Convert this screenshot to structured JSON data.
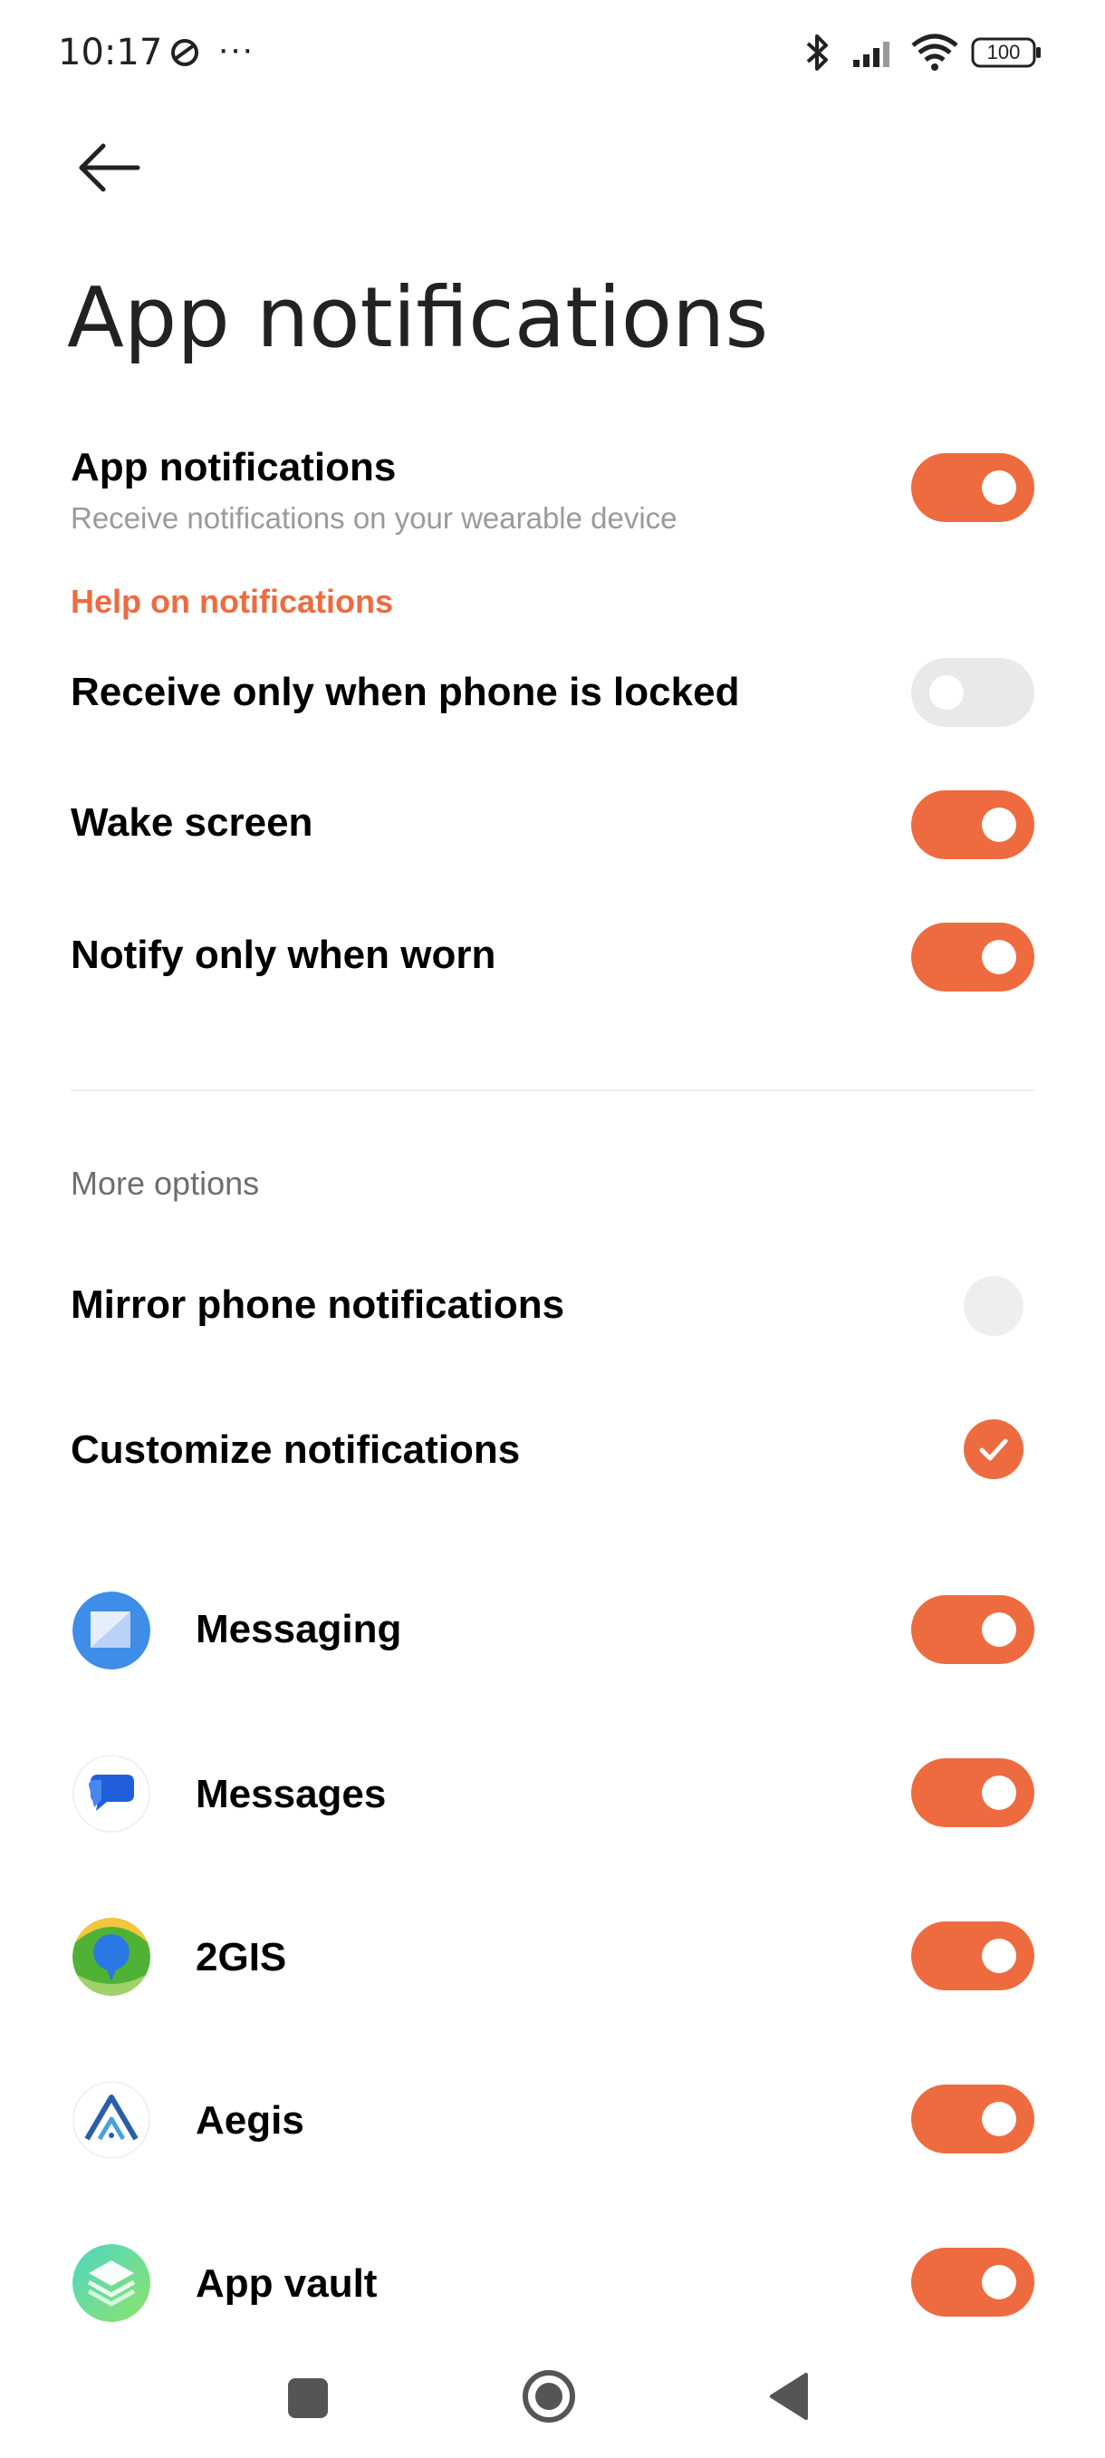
{
  "status_bar": {
    "time": "10:17",
    "more": "···",
    "battery": "100",
    "icons": [
      "location-compass-icon",
      "bluetooth-icon",
      "signal-icon",
      "wifi-icon",
      "battery-icon"
    ]
  },
  "header": {
    "back_icon": "back-arrow-icon",
    "title": "App notifications"
  },
  "main_settings": {
    "app_notifications": {
      "title": "App notifications",
      "subtitle": "Receive notifications on your wearable device",
      "enabled": true
    },
    "help_link": "Help on notifications",
    "locked_only": {
      "title": "Receive only when phone is locked",
      "enabled": false
    },
    "wake_screen": {
      "title": "Wake screen",
      "enabled": true
    },
    "notify_worn": {
      "title": "Notify only when worn",
      "enabled": true
    }
  },
  "more_options": {
    "header": "More options",
    "mirror": {
      "title": "Mirror phone notifications",
      "selected": false
    },
    "customize": {
      "title": "Customize notifications",
      "selected": true
    }
  },
  "apps": [
    {
      "name": "Messaging",
      "icon": "messaging-icon",
      "enabled": true
    },
    {
      "name": "Messages",
      "icon": "messages-icon",
      "enabled": true
    },
    {
      "name": "2GIS",
      "icon": "2gis-icon",
      "enabled": true
    },
    {
      "name": "Aegis",
      "icon": "aegis-icon",
      "enabled": true
    },
    {
      "name": "App vault",
      "icon": "app-vault-icon",
      "enabled": true
    }
  ],
  "colors": {
    "accent": "#ee6b3f",
    "toggle_off": "#e9e9e9",
    "subtitle": "#9a9a9a",
    "divider": "#eeeeee"
  },
  "nav_bar": {
    "icons": [
      "recents-square-icon",
      "home-circle-icon",
      "back-triangle-icon"
    ]
  }
}
